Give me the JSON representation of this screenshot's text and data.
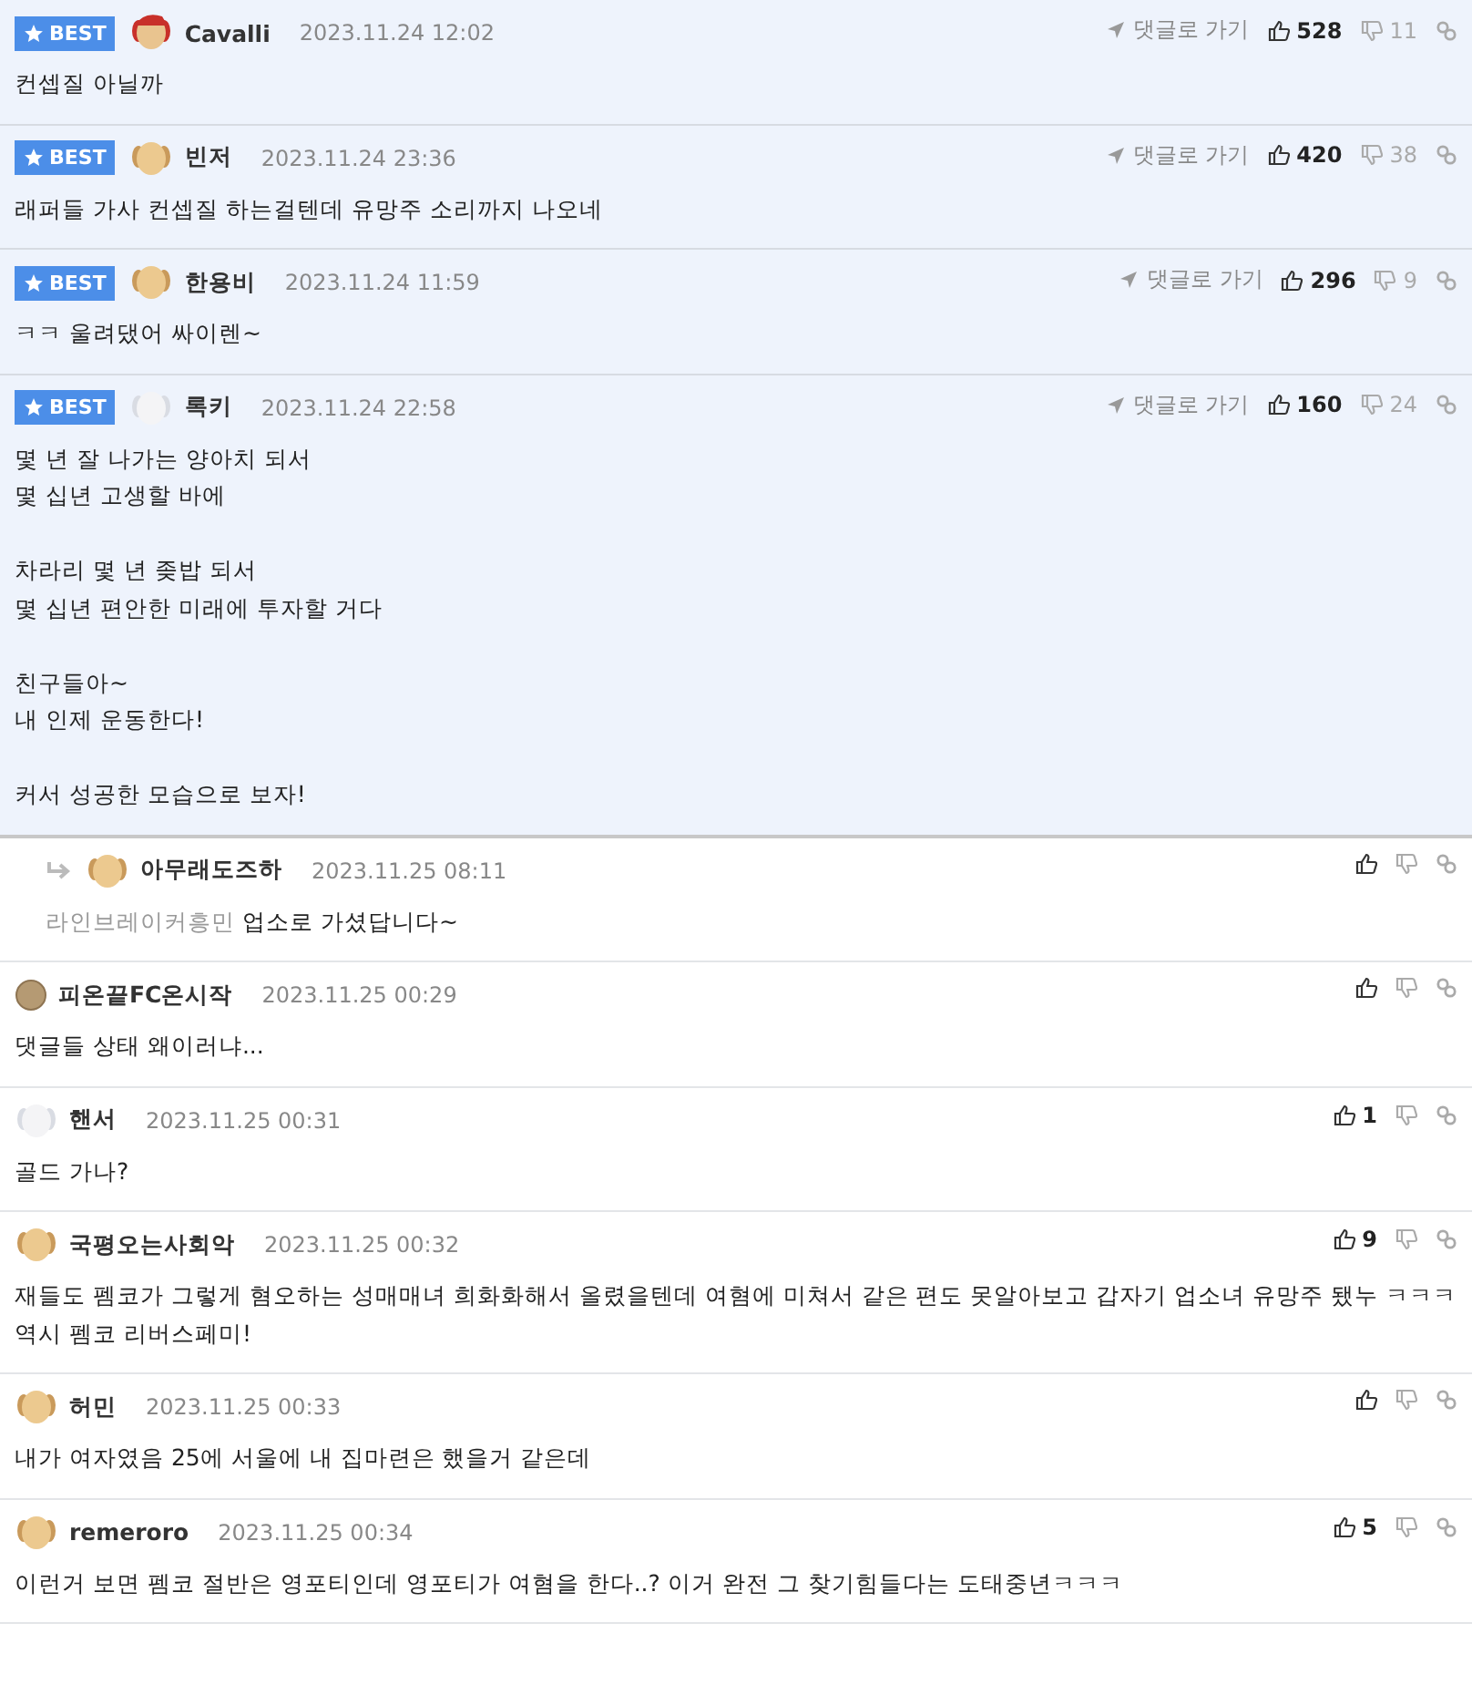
{
  "comments": [
    {
      "best": true,
      "best_label": "BEST",
      "reply": false,
      "avatar": {
        "kind": "dog-red"
      },
      "nickname": "Cavalli",
      "date": "2023.11.24 12:02",
      "goto": "댓글로 가기",
      "likes": "528",
      "dislikes": "11",
      "paragraphs": [
        [
          "컨셉질 아닐까"
        ]
      ]
    },
    {
      "best": true,
      "best_label": "BEST",
      "reply": false,
      "avatar": {
        "kind": "dog"
      },
      "nickname": "빈저",
      "date": "2023.11.24 23:36",
      "goto": "댓글로 가기",
      "likes": "420",
      "dislikes": "38",
      "paragraphs": [
        [
          "래퍼들 가사 컨셉질 하는걸텐데 유망주 소리까지 나오네"
        ]
      ]
    },
    {
      "best": true,
      "best_label": "BEST",
      "reply": false,
      "avatar": {
        "kind": "dog"
      },
      "nickname": "한용비",
      "date": "2023.11.24 11:59",
      "goto": "댓글로 가기",
      "likes": "296",
      "dislikes": "9",
      "paragraphs": [
        [
          "ㅋㅋ 울려댔어 싸이렌~"
        ]
      ]
    },
    {
      "best": true,
      "best_label": "BEST",
      "reply": false,
      "avatar": {
        "kind": "white-dog"
      },
      "nickname": "록키",
      "date": "2023.11.24 22:58",
      "goto": "댓글로 가기",
      "likes": "160",
      "dislikes": "24",
      "paragraphs": [
        [
          "몇 년 잘 나가는 양아치 되서",
          "몇 십년 고생할 바에"
        ],
        [
          "차라리 몇 년 좆밥 되서",
          "몇 십년 편안한 미래에 투자할 거다"
        ],
        [
          "친구들아~",
          "내 인제 운동한다!"
        ],
        [
          "커서 성공한 모습으로 보자!"
        ]
      ]
    },
    {
      "best": false,
      "reply": true,
      "avatar": {
        "kind": "dog"
      },
      "nickname": "아무래도즈하",
      "date": "2023.11.25 08:11",
      "mention": "라인브레이커흥민",
      "paragraphs": [
        [
          "업소로 가셨답니다~"
        ]
      ]
    },
    {
      "best": false,
      "reply": false,
      "avatar": {
        "kind": "ball"
      },
      "nickname": "피온끝FC온시작",
      "date": "2023.11.25 00:29",
      "paragraphs": [
        [
          "댓글들 상태 왜이러냐..."
        ]
      ]
    },
    {
      "best": false,
      "reply": false,
      "avatar": {
        "kind": "white-dog"
      },
      "nickname": "핸서",
      "date": "2023.11.25 00:31",
      "likes": "1",
      "paragraphs": [
        [
          "골드 가나?"
        ]
      ]
    },
    {
      "best": false,
      "reply": false,
      "avatar": {
        "kind": "dog"
      },
      "nickname": "국평오는사회악",
      "date": "2023.11.25 00:32",
      "likes": "9",
      "paragraphs": [
        [
          "재들도 펨코가 그렇게 혐오하는 성매매녀 희화화해서 올렸을텐데 여혐에 미쳐서 같은 편도 못알아보고 갑자기 업소녀 유망주 됐누 ㅋㅋㅋ 역시 펨코 리버스페미!"
        ]
      ]
    },
    {
      "best": false,
      "reply": false,
      "avatar": {
        "kind": "dog"
      },
      "nickname": "허민",
      "date": "2023.11.25 00:33",
      "paragraphs": [
        [
          "내가 여자였음 25에 서울에 내 집마련은 했을거 같은데"
        ]
      ]
    },
    {
      "best": false,
      "reply": false,
      "avatar": {
        "kind": "dog"
      },
      "nickname": "remeroro",
      "date": "2023.11.25 00:34",
      "likes": "5",
      "paragraphs": [
        [
          "이런거 보면 펨코 절반은 영포티인데 영포티가 여혐을 한다..? 이거 완전 그 찾기힘들다는 도태중년ㅋㅋㅋ"
        ]
      ]
    }
  ]
}
